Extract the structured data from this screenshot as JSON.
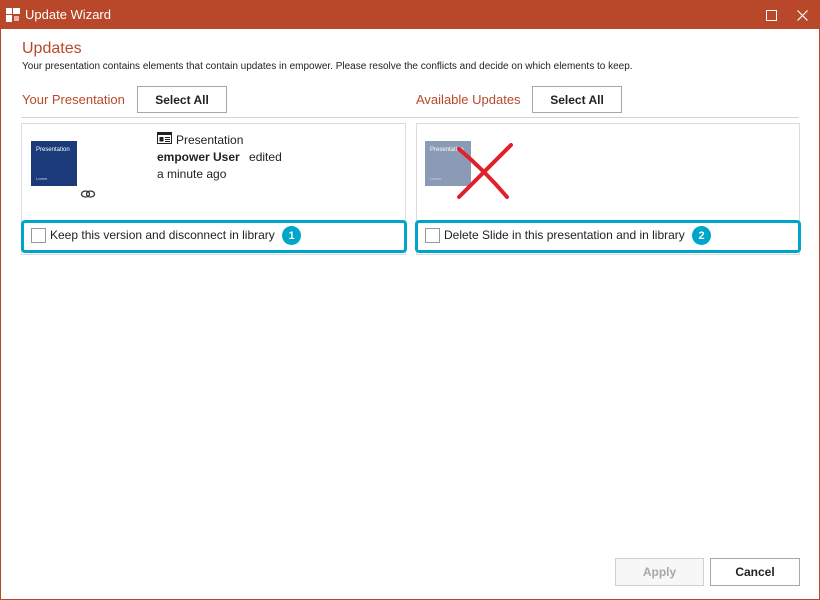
{
  "window": {
    "title": "Update Wizard",
    "accent_color": "#b9482a",
    "highlight_color": "#00a6c9"
  },
  "header": {
    "heading": "Updates",
    "subtitle": "Your presentation contains elements that contain updates in empower. Please resolve the conflicts and decide on which elements to keep."
  },
  "left": {
    "label": "Your Presentation",
    "select_all": "Select All",
    "thumbnail": {
      "title": "Presentation",
      "subtitle": "Lorem"
    },
    "type": "Presentation",
    "user": "empower User",
    "action": "edited",
    "time": "a minute ago",
    "option_label": "Keep this version and disconnect in library",
    "badge": "1"
  },
  "right": {
    "label": "Available Updates",
    "select_all": "Select All",
    "thumbnail": {
      "title": "Presentation",
      "subtitle": "Lorem"
    },
    "option_label": "Delete Slide in this presentation and in library",
    "badge": "2"
  },
  "footer": {
    "apply": "Apply",
    "cancel": "Cancel"
  },
  "icons": [
    "app-logo-icon",
    "maximize-icon",
    "close-icon",
    "link-icon",
    "presentation-icon",
    "delete-x-icon"
  ]
}
